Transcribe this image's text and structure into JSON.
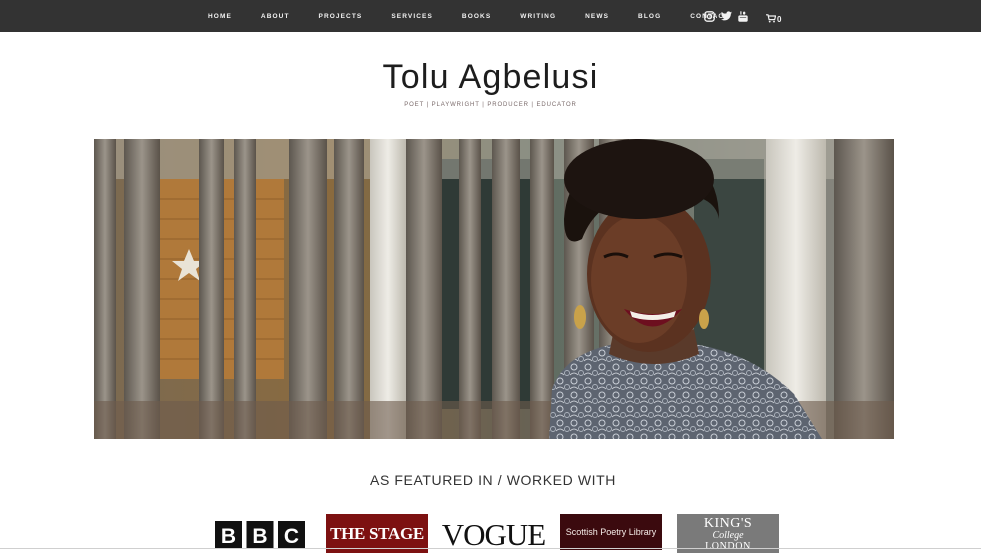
{
  "nav": {
    "items": [
      "HOME",
      "ABOUT",
      "PROJECTS",
      "SERVICES",
      "BOOKS",
      "WRITING",
      "NEWS",
      "BLOG",
      "CONTACT"
    ],
    "social_icons": [
      "instagram-icon",
      "twitter-icon",
      "youtube-icon"
    ],
    "cart_icon": "cart-icon",
    "cart_count": "0"
  },
  "header": {
    "title": "Tolu Agbelusi",
    "tagline": "POET | PLAYWRIGHT | PRODUCER | EDUCATOR"
  },
  "hero": {
    "icon": "portrait-photo"
  },
  "featured": {
    "heading": "AS FEATURED IN / WORKED WITH",
    "logos": [
      {
        "name": "bbc",
        "letters": [
          "B",
          "B",
          "C"
        ]
      },
      {
        "name": "the-stage",
        "text": "THE STAGE"
      },
      {
        "name": "vogue",
        "text": "VOGUE"
      },
      {
        "name": "scottish-poetry-library",
        "text": "Scottish Poetry Library"
      },
      {
        "name": "kings-college-london",
        "line1": "KING'S",
        "line2": "College",
        "line3": "LONDON"
      }
    ]
  },
  "colors": {
    "topbar": "#333333",
    "nav_text": "#f2f2f2",
    "stage_red": "#7d1111",
    "spl_maroon": "#3b0a0e",
    "kings_grey": "#7a7a7a"
  }
}
